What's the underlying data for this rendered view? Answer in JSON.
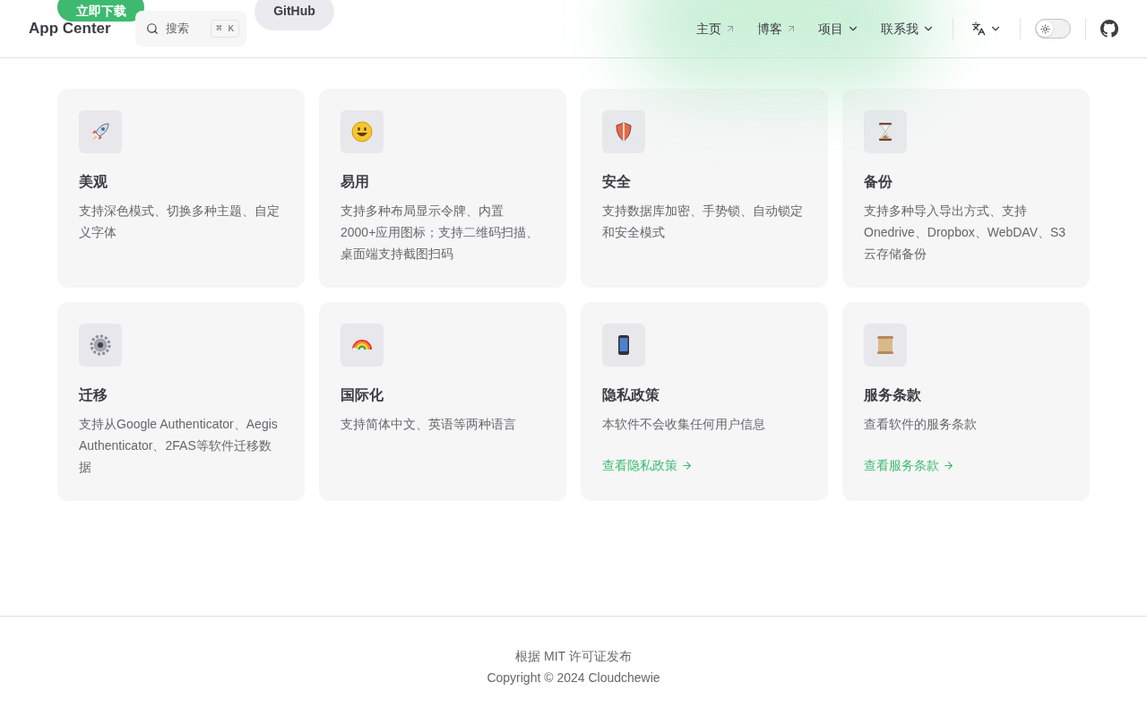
{
  "header": {
    "brand": "App Center",
    "hero_buttons": [
      {
        "label": "立即下载",
        "kind": "primary"
      },
      {
        "label": "GitHub",
        "kind": "secondary"
      }
    ],
    "search": {
      "placeholder": "搜索",
      "shortcut": "⌘ K"
    },
    "nav": [
      {
        "label": "主页",
        "kind": "external"
      },
      {
        "label": "博客",
        "kind": "external"
      },
      {
        "label": "项目",
        "kind": "dropdown"
      },
      {
        "label": "联系我",
        "kind": "dropdown"
      }
    ],
    "dark_mode": false
  },
  "features": [
    {
      "kind": "rocket",
      "title": "美观",
      "details": "支持深色模式、切换多种主题、自定义字体"
    },
    {
      "kind": "smile",
      "title": "易用",
      "details": "支持多种布局显示令牌、内置2000+应用图标；支持二维码扫描、桌面端支持截图扫码"
    },
    {
      "kind": "shield",
      "title": "安全",
      "details": "支持数据库加密、手势锁、自动锁定和安全模式"
    },
    {
      "kind": "hourglass",
      "title": "备份",
      "details": "支持多种导入导出方式、支持Onedrive、Dropbox、WebDAV、S3云存储备份"
    },
    {
      "kind": "gear",
      "title": "迁移",
      "details": "支持从Google Authenticator、Aegis Authenticator、2FAS等软件迁移数据"
    },
    {
      "kind": "rainbow",
      "title": "国际化",
      "details": "支持简体中文、英语等两种语言"
    },
    {
      "kind": "phone",
      "title": "隐私政策",
      "details": "本软件不会收集任何用户信息",
      "link": "查看隐私政策"
    },
    {
      "kind": "scroll",
      "title": "服务条款",
      "details": "查看软件的服务条款",
      "link": "查看服务条款"
    }
  ],
  "footer": {
    "message": "根据 MIT 许可证发布",
    "copyright": "Copyright © 2024 Cloudchewie"
  }
}
